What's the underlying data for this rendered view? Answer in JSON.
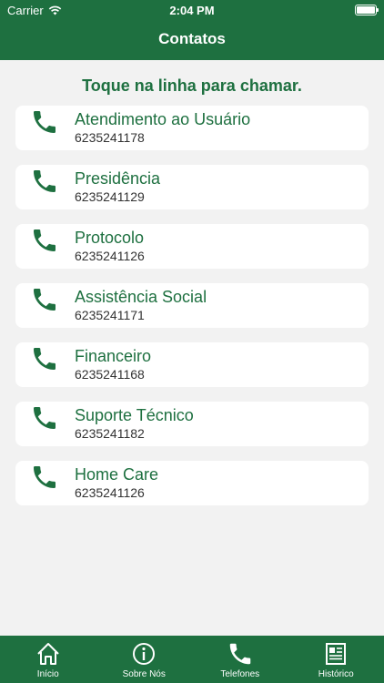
{
  "status_bar": {
    "carrier": "Carrier",
    "time": "2:04 PM"
  },
  "header": {
    "title": "Contatos"
  },
  "instruction": "Toque na linha para chamar.",
  "contacts": [
    {
      "name": "Atendimento ao Usuário",
      "number": "6235241178"
    },
    {
      "name": "Presidência",
      "number": "6235241129"
    },
    {
      "name": "Protocolo",
      "number": "6235241126"
    },
    {
      "name": "Assistência Social",
      "number": "6235241171"
    },
    {
      "name": "Financeiro",
      "number": "6235241168"
    },
    {
      "name": "Suporte Técnico",
      "number": "6235241182"
    },
    {
      "name": "Home Care",
      "number": "6235241126"
    }
  ],
  "tab_bar": {
    "tabs": [
      {
        "label": "Início",
        "icon": "home-icon"
      },
      {
        "label": "Sobre Nós",
        "icon": "info-icon"
      },
      {
        "label": "Telefones",
        "icon": "phone-icon"
      },
      {
        "label": "Histórico",
        "icon": "newspaper-icon"
      }
    ]
  },
  "colors": {
    "primary": "#1e7040",
    "background": "#f2f2f2",
    "card": "#ffffff"
  }
}
